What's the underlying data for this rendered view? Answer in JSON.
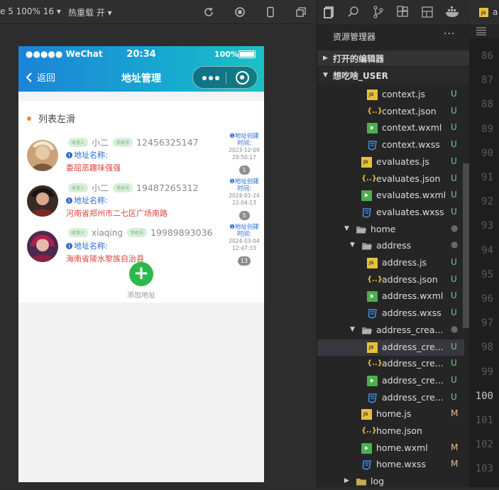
{
  "toolbar": {
    "device_text": "e 5 100% 16 ▾",
    "hot_reload_text": "热重载 开 ▾"
  },
  "phone": {
    "status": {
      "carrier": "●●●●● WeChat",
      "time": "20:34",
      "battery": "100%"
    },
    "nav": {
      "back_label": "返回",
      "title": "地址管理"
    },
    "list_title": "列表左滑",
    "addresses": [
      {
        "receiver_tag": "收货人",
        "name": "小二",
        "phone_tag": "手机号",
        "phone": "12456325147",
        "address_label": "地址名称:",
        "address": "委屈恶趣味强强",
        "created_label_1": "❶地址创建",
        "created_label_2": "时间:",
        "created_date": "2023-12-09",
        "created_time": "20:50:17",
        "count": "1"
      },
      {
        "receiver_tag": "收货人",
        "name": "小二",
        "phone_tag": "手机号",
        "phone": "19487265312",
        "address_label": "地址名称:",
        "address": "河南省郑州市二七区广场南路",
        "created_label_1": "❶地址创建",
        "created_label_2": "时间:",
        "created_date": "2024-01-24",
        "created_time": "22:04:13",
        "count": "5"
      },
      {
        "receiver_tag": "收货人",
        "name": "xiaqing",
        "phone_tag": "手机号",
        "phone": "19989893036",
        "address_label": "地址名称:",
        "address": "海南省陵水黎族自治县",
        "created_label_1": "❶地址创建",
        "created_label_2": "时间:",
        "created_date": "2024-03-04",
        "created_time": "12:47:33",
        "count": "13"
      }
    ],
    "add_button": "+",
    "add_label": "添加地址"
  },
  "explorer": {
    "title": "资源管理器",
    "more": "···",
    "open_editors": "打开的编辑器",
    "project": "想吃啥_USER",
    "files": [
      {
        "name": "context.js",
        "type": "js",
        "status": "U"
      },
      {
        "name": "context.json",
        "type": "json",
        "status": "U"
      },
      {
        "name": "context.wxml",
        "type": "wxml",
        "status": "U"
      },
      {
        "name": "context.wxss",
        "type": "wxss",
        "status": "U"
      },
      {
        "name": "evaluates.js",
        "type": "js",
        "status": "U"
      },
      {
        "name": "evaluates.json",
        "type": "json",
        "status": "U"
      },
      {
        "name": "evaluates.wxml",
        "type": "wxml",
        "status": "U"
      },
      {
        "name": "evaluates.wxss",
        "type": "wxss",
        "status": "U"
      },
      {
        "name": "home",
        "type": "folder",
        "status": "●"
      },
      {
        "name": "address",
        "type": "folder",
        "status": "●"
      },
      {
        "name": "address.js",
        "type": "js",
        "status": "U"
      },
      {
        "name": "address.json",
        "type": "json",
        "status": "U"
      },
      {
        "name": "address.wxml",
        "type": "wxml",
        "status": "U"
      },
      {
        "name": "address.wxss",
        "type": "wxss",
        "status": "U"
      },
      {
        "name": "address_crea...",
        "type": "folder",
        "status": "●"
      },
      {
        "name": "address_cre...",
        "type": "js",
        "status": "U"
      },
      {
        "name": "address_cre...",
        "type": "json",
        "status": "U"
      },
      {
        "name": "address_cre...",
        "type": "wxml",
        "status": "U"
      },
      {
        "name": "address_cre...",
        "type": "wxss",
        "status": "U"
      },
      {
        "name": "home.js",
        "type": "js",
        "status": "M"
      },
      {
        "name": "home.json",
        "type": "json",
        "status": ""
      },
      {
        "name": "home.wxml",
        "type": "wxml",
        "status": "M"
      },
      {
        "name": "home.wxss",
        "type": "wxss",
        "status": "M"
      },
      {
        "name": "log",
        "type": "folder",
        "status": ""
      }
    ]
  },
  "editor": {
    "tab_label": "a",
    "line_numbers": [
      "86",
      "87",
      "88",
      "89",
      "90",
      "91",
      "92",
      "93",
      "94",
      "95",
      "96",
      "97",
      "98",
      "99",
      "100",
      "101",
      "102",
      "103"
    ],
    "current_line": "100"
  }
}
